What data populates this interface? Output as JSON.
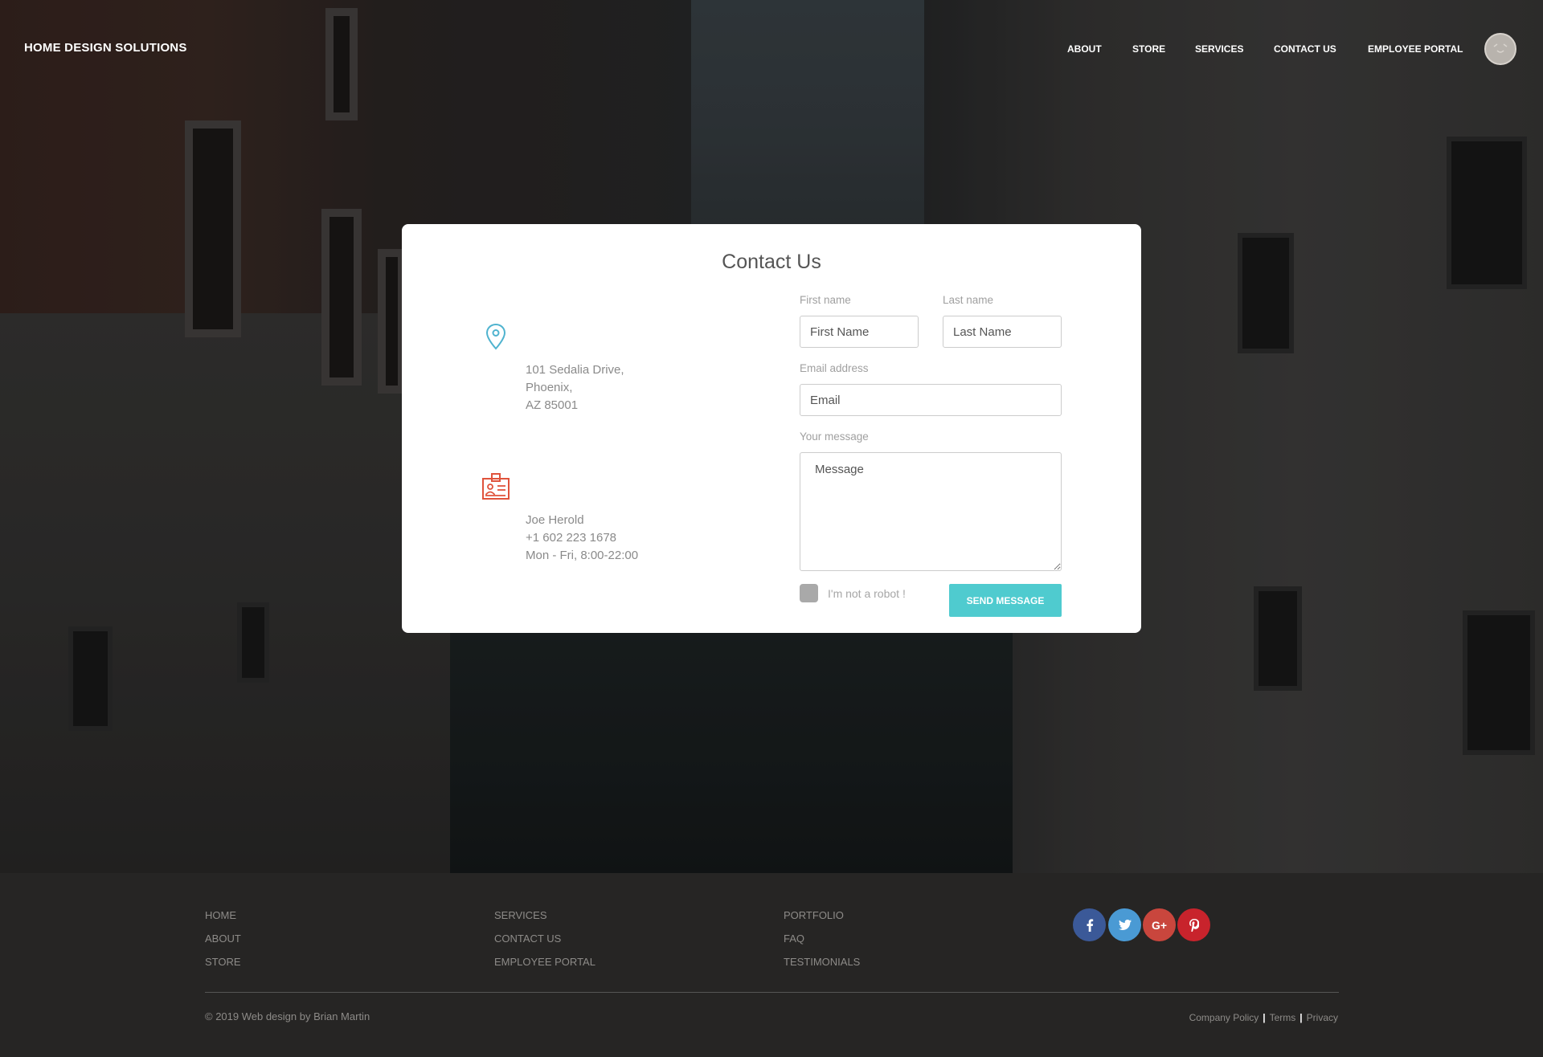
{
  "header": {
    "brand": "HOME DESIGN SOLUTIONS",
    "nav": [
      "ABOUT",
      "STORE",
      "SERVICES",
      "CONTACT US",
      "EMPLOYEE PORTAL"
    ]
  },
  "contact": {
    "title": "Contact Us",
    "address": [
      "101 Sedalia Drive,",
      "Phoenix,",
      "AZ 85001"
    ],
    "person": [
      "Joe Herold",
      "+1 602 223 1678",
      "Mon - Fri, 8:00-22:00"
    ],
    "form": {
      "first_name_label": "First name",
      "first_name_placeholder": "First Name",
      "last_name_label": "Last name",
      "last_name_placeholder": "Last Name",
      "email_label": "Email address",
      "email_placeholder": "Email",
      "message_label": "Your message",
      "message_placeholder": "Message",
      "robot_label": "I'm not a robot !",
      "send_label": "SEND MESSAGE"
    }
  },
  "footer": {
    "col1": [
      "HOME",
      "ABOUT",
      "STORE"
    ],
    "col2": [
      "SERVICES",
      "CONTACT US",
      "EMPLOYEE PORTAL"
    ],
    "col3": [
      "PORTFOLIO",
      "FAQ",
      "TESTIMONIALS"
    ],
    "social": [
      {
        "icon": "facebook-icon",
        "glyph": "f",
        "color": "#3b5998"
      },
      {
        "icon": "twitter-icon",
        "glyph": "t",
        "color": "#4a9ad4"
      },
      {
        "icon": "google-plus-icon",
        "glyph": "G+",
        "color": "#c9463d"
      },
      {
        "icon": "pinterest-icon",
        "glyph": "P",
        "color": "#c8232c"
      }
    ],
    "copyright": "© 2019 Web design by Brian Martin",
    "legal": [
      "Company Policy",
      "Terms",
      "Privacy"
    ]
  },
  "colors": {
    "accent": "#4fcbcf",
    "pin_icon": "#4fb3cf",
    "badge_icon": "#e0533c"
  }
}
